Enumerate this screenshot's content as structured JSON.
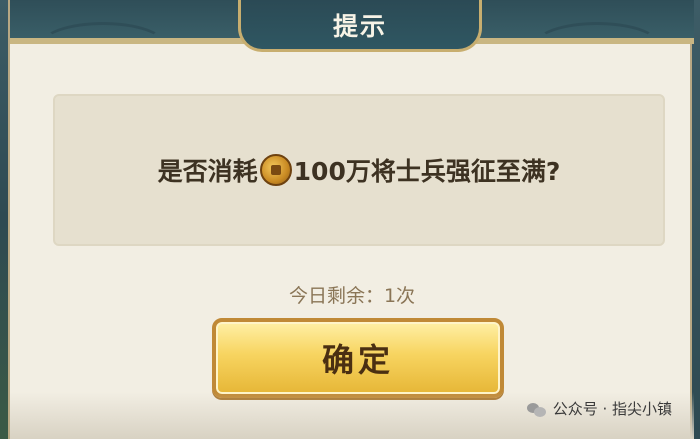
{
  "dialog": {
    "title": "提示",
    "message_before": "是否消耗",
    "message_after": "100万将士兵强征至满?",
    "currency_icon": "copper-coin-icon",
    "remaining_text": "今日剩余：1次",
    "confirm_label": "确定"
  },
  "watermark": {
    "text": "公众号 · 指尖小镇",
    "icon": "wechat-icon"
  }
}
